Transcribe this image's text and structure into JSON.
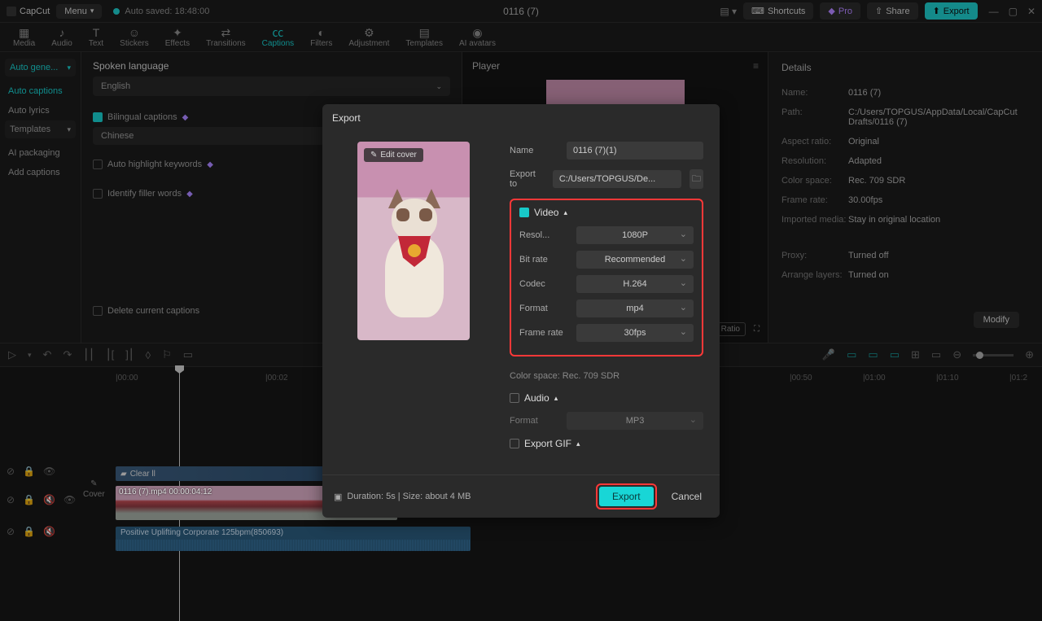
{
  "topbar": {
    "brand": "CapCut",
    "menu": "Menu",
    "autosave": "Auto saved: 18:48:00",
    "title": "0116 (7)",
    "shortcuts": "Shortcuts",
    "pro": "Pro",
    "share": "Share",
    "export": "Export"
  },
  "tooltabs": [
    "Media",
    "Audio",
    "Text",
    "Stickers",
    "Effects",
    "Transitions",
    "Captions",
    "Filters",
    "Adjustment",
    "Templates",
    "AI avatars"
  ],
  "toolicons": [
    "▦",
    "♪",
    "T",
    "☺",
    "✦",
    "⇄",
    "㏄",
    "◐",
    "⚙",
    "▤",
    "◉"
  ],
  "sidebar": {
    "autogen": "Auto gene...",
    "items": [
      "Auto captions",
      "Auto lyrics"
    ],
    "templates": "Templates",
    "items2": [
      "AI packaging",
      "Add captions"
    ]
  },
  "captions": {
    "spoken": "Spoken language",
    "english": "English",
    "bilingual": "Bilingual captions",
    "chinese": "Chinese",
    "autohighlight": "Auto highlight keywords",
    "filler": "Identify filler words",
    "delete": "Delete current captions"
  },
  "player": {
    "title": "Player",
    "ratio": "Ratio"
  },
  "details": {
    "title": "Details",
    "rows": [
      {
        "label": "Name:",
        "val": "0116 (7)"
      },
      {
        "label": "Path:",
        "val": "C:/Users/TOPGUS/AppData/Local/CapCut Drafts/0116 (7)"
      },
      {
        "label": "Aspect ratio:",
        "val": "Original"
      },
      {
        "label": "Resolution:",
        "val": "Adapted"
      },
      {
        "label": "Color space:",
        "val": "Rec. 709 SDR"
      },
      {
        "label": "Frame rate:",
        "val": "30.00fps"
      },
      {
        "label": "Imported media:",
        "val": "Stay in original location"
      },
      {
        "label": "Proxy:",
        "val": "Turned off"
      },
      {
        "label": "Arrange layers:",
        "val": "Turned on"
      }
    ],
    "modify": "Modify"
  },
  "timeline": {
    "ticks": [
      "|00:00",
      "|00:02",
      "|00:50",
      "|01:00",
      "|01:10",
      "|01:2"
    ],
    "cover": "Cover",
    "caption_clip": "Clear ll",
    "video_clip": "0116 (7).mp4   00:00:04:12",
    "audio_clip": "Positive Uplifting Corporate 125bpm(850693)"
  },
  "modal": {
    "title": "Export",
    "edit_cover": "Edit cover",
    "name_label": "Name",
    "name_val": "0116 (7)(1)",
    "exportto_label": "Export to",
    "exportto_val": "C:/Users/TOPGUS/De...",
    "video_section": "Video",
    "opts": [
      {
        "label": "Resol...",
        "val": "1080P"
      },
      {
        "label": "Bit rate",
        "val": "Recommended"
      },
      {
        "label": "Codec",
        "val": "H.264"
      },
      {
        "label": "Format",
        "val": "mp4"
      },
      {
        "label": "Frame rate",
        "val": "30fps"
      }
    ],
    "colorspace": "Color space: Rec. 709 SDR",
    "audio_section": "Audio",
    "audio_format_label": "Format",
    "audio_format_val": "MP3",
    "gif_section": "Export GIF",
    "duration": "Duration: 5s | Size: about 4 MB",
    "export_btn": "Export",
    "cancel_btn": "Cancel"
  }
}
